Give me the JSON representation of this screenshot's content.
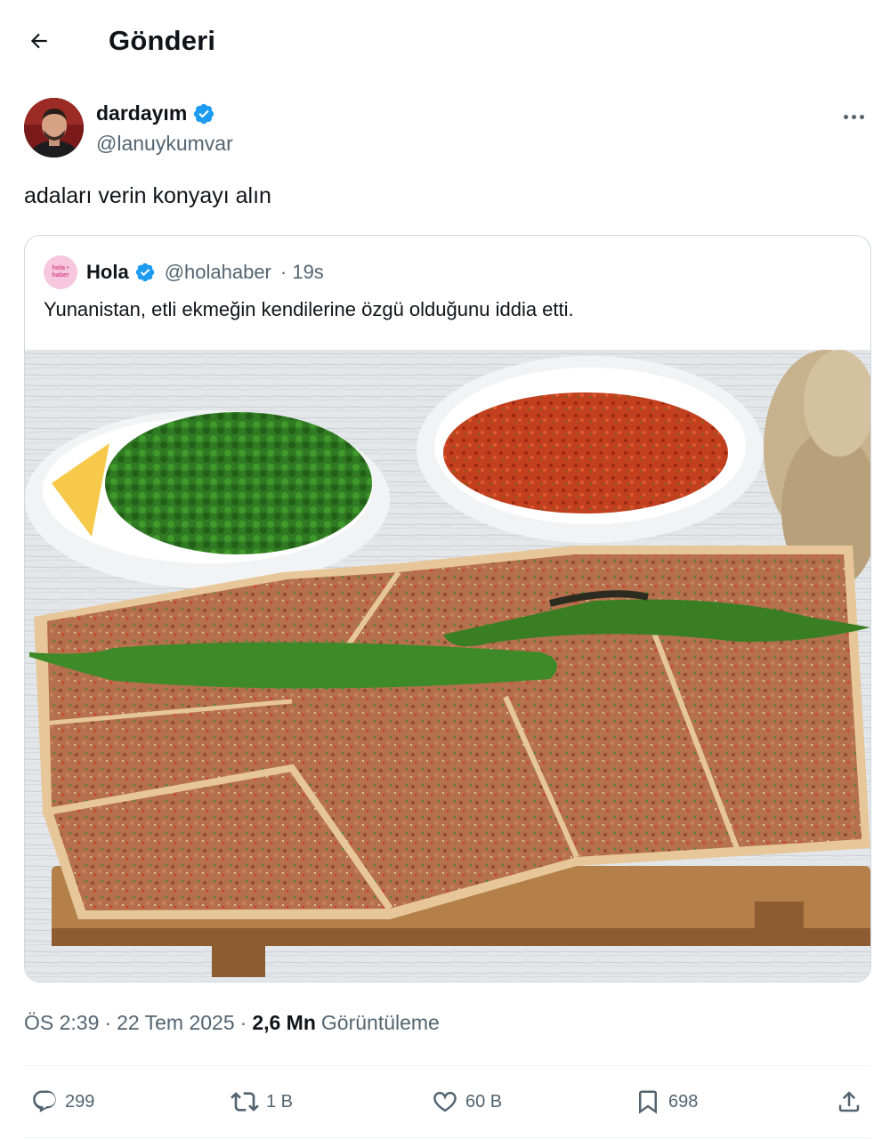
{
  "header": {
    "title": "Gönderi",
    "back_icon": "arrow-left-icon"
  },
  "author": {
    "name": "dardayım",
    "handle": "@lanuykumvar",
    "verified": true,
    "verified_color": "#1d9bf0"
  },
  "tweet": {
    "text": "adaları verin konyayı alın"
  },
  "quote": {
    "avatar_text": "hola • haber",
    "name": "Hola",
    "handle": "@holahaber",
    "time": "· 19s",
    "text": "Yunanistan, etli ekmeğin kendilerine özgü olduğunu iddia etti.",
    "image_subject": "lahmacun-photo"
  },
  "meta": {
    "time": "ÖS 2:39",
    "sep1": "·",
    "date": "22 Tem 2025",
    "sep2": "·",
    "views": "2,6 Mn",
    "views_label": "Görüntüleme"
  },
  "actions": {
    "replies": "299",
    "retweets": "1 B",
    "likes": "60 B",
    "bookmarks": "698"
  }
}
